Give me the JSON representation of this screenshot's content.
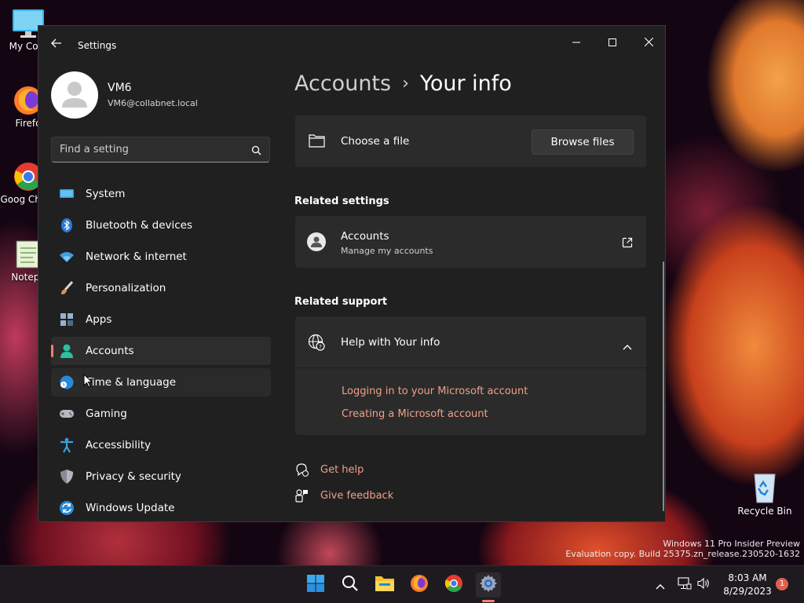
{
  "desktop": {
    "icons": [
      {
        "label": "My Com"
      },
      {
        "label": "Firefo"
      },
      {
        "label": "Goog Chron"
      },
      {
        "label": "Notepa"
      },
      {
        "label": "Recycle Bin"
      }
    ],
    "watermark": {
      "line1": "Windows 11 Pro Insider Preview",
      "line2": "Evaluation copy. Build 25375.zn_release.230520-1632"
    }
  },
  "window": {
    "title": "Settings",
    "user": {
      "name": "VM6",
      "email": "VM6@collabnet.local"
    },
    "search": {
      "placeholder": "Find a setting"
    },
    "nav": [
      {
        "label": "System",
        "icon": "monitor-icon"
      },
      {
        "label": "Bluetooth & devices",
        "icon": "bluetooth-icon"
      },
      {
        "label": "Network & internet",
        "icon": "wifi-icon"
      },
      {
        "label": "Personalization",
        "icon": "paintbrush-icon"
      },
      {
        "label": "Apps",
        "icon": "apps-icon"
      },
      {
        "label": "Accounts",
        "icon": "person-icon",
        "selected": true
      },
      {
        "label": "Time & language",
        "icon": "globe-clock-icon"
      },
      {
        "label": "Gaming",
        "icon": "gamepad-icon"
      },
      {
        "label": "Accessibility",
        "icon": "accessibility-icon"
      },
      {
        "label": "Privacy & security",
        "icon": "shield-icon"
      },
      {
        "label": "Windows Update",
        "icon": "update-icon"
      }
    ],
    "breadcrumb": {
      "parent": "Accounts",
      "separator": "›",
      "current": "Your info"
    },
    "choose_file": {
      "label": "Choose a file",
      "button": "Browse files"
    },
    "related_settings": {
      "heading": "Related settings",
      "accounts": {
        "title": "Accounts",
        "subtitle": "Manage my accounts"
      }
    },
    "related_support": {
      "heading": "Related support",
      "help": {
        "title": "Help with Your info",
        "links": [
          "Logging in to your Microsoft account",
          "Creating a Microsoft account"
        ]
      }
    },
    "footer": {
      "get_help": "Get help",
      "give_feedback": "Give feedback"
    }
  },
  "taskbar": {
    "time": "8:03 AM",
    "date": "8/29/2023",
    "notification_count": "1"
  },
  "colors": {
    "accent": "#f08070",
    "link": "#f0a088",
    "card": "#2b2b2b",
    "window": "#202020"
  }
}
